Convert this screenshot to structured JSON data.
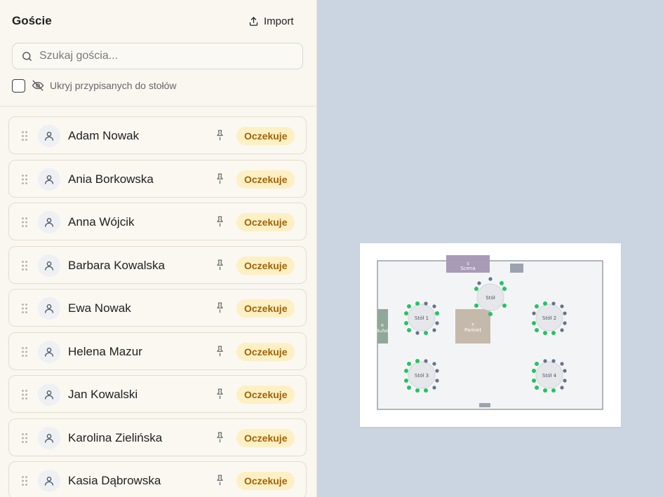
{
  "sidebar": {
    "title": "Goście",
    "import_label": "Import",
    "search_placeholder": "Szukaj gościa...",
    "hide_assigned_label": "Ukryj przypisanych do stołów",
    "hide_assigned_checked": false
  },
  "guests": [
    {
      "name": "Adam Nowak",
      "status": "Oczekuje"
    },
    {
      "name": "Ania Borkowska",
      "status": "Oczekuje"
    },
    {
      "name": "Anna Wójcik",
      "status": "Oczekuje"
    },
    {
      "name": "Barbara Kowalska",
      "status": "Oczekuje"
    },
    {
      "name": "Ewa Nowak",
      "status": "Oczekuje"
    },
    {
      "name": "Helena Mazur",
      "status": "Oczekuje"
    },
    {
      "name": "Jan Kowalski",
      "status": "Oczekuje"
    },
    {
      "name": "Karolina Zielińska",
      "status": "Oczekuje"
    },
    {
      "name": "Kasia Dąbrowska",
      "status": "Oczekuje"
    }
  ],
  "floorplan": {
    "stage_label": "Scena",
    "dancefloor_label": "Parkiet",
    "buffet_label": "Bufet",
    "tables": [
      {
        "label": "Stół"
      },
      {
        "label": "Stół 1"
      },
      {
        "label": "Stół 2"
      },
      {
        "label": "Stół 3"
      },
      {
        "label": "Stół 4"
      }
    ]
  },
  "colors": {
    "badge_bg": "#fdf0c4",
    "badge_text": "#a16207",
    "seat_assigned": "#22c55e",
    "seat_empty": "#64748b",
    "workspace_bg": "#cbd5e1"
  }
}
